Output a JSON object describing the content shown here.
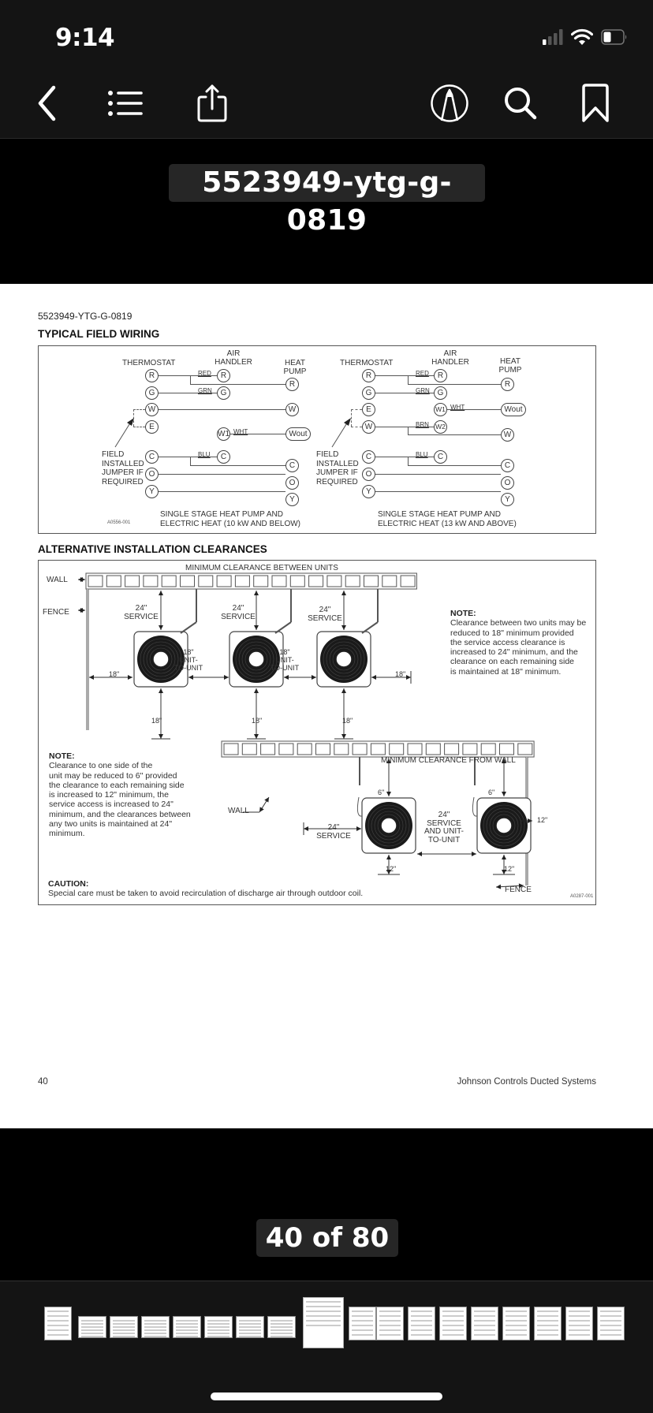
{
  "status_bar": {
    "time": "9:14",
    "signal_icon": "cellular-signal-icon",
    "wifi_icon": "wifi-icon",
    "battery_icon": "battery-icon"
  },
  "toolbar": {
    "back_icon": "chevron-left-icon",
    "outline_icon": "list-icon",
    "share_icon": "share-icon",
    "markup_icon": "markup-pen-icon",
    "search_icon": "search-icon",
    "bookmark_icon": "bookmark-icon"
  },
  "document": {
    "title": "5523949-ytg-g-0819"
  },
  "page": {
    "doc_id": "5523949-YTG-G-0819",
    "section1_title": "TYPICAL FIELD WIRING",
    "wiring_left": {
      "thermostat": "THERMOSTAT",
      "air_handler": [
        "AIR",
        "HANDLER"
      ],
      "heat_pump": [
        "HEAT",
        "PUMP"
      ],
      "thermostat_terminals": [
        "R",
        "G",
        "W",
        "E",
        "C",
        "O",
        "Y"
      ],
      "air_handler_terminals": [
        "R",
        "G",
        "W1",
        "C"
      ],
      "heat_pump_terminals": [
        "R",
        "W",
        "Wout",
        "C",
        "O",
        "Y"
      ],
      "wire_labels": [
        "RED",
        "GRN",
        "WHT",
        "BLU"
      ],
      "jumper_note": [
        "FIELD",
        "INSTALLED",
        "JUMPER IF",
        "REQUIRED"
      ],
      "caption": [
        "SINGLE STAGE HEAT PUMP AND",
        "ELECTRIC HEAT (10 kW AND BELOW)"
      ],
      "figure_id": "A0556-001"
    },
    "wiring_right": {
      "thermostat": "THERMOSTAT",
      "air_handler": [
        "AIR",
        "HANDLER"
      ],
      "heat_pump": [
        "HEAT",
        "PUMP"
      ],
      "thermostat_terminals": [
        "R",
        "G",
        "E",
        "W",
        "C",
        "O",
        "Y"
      ],
      "air_handler_terminals": [
        "R",
        "G",
        "W1",
        "W2",
        "C"
      ],
      "heat_pump_terminals": [
        "R",
        "Wout",
        "W",
        "C",
        "O",
        "Y"
      ],
      "wire_labels": [
        "RED",
        "GRN",
        "WHT",
        "BRN",
        "BLU"
      ],
      "jumper_note": [
        "FIELD",
        "INSTALLED",
        "JUMPER IF",
        "REQUIRED"
      ],
      "caption": [
        "SINGLE STAGE HEAT PUMP AND",
        "ELECTRIC HEAT (13 kW AND ABOVE)"
      ]
    },
    "section2_title": "ALTERNATIVE INSTALLATION CLEARANCES",
    "clearance_top": {
      "heading": "MINIMUM CLEARANCE BETWEEN UNITS",
      "wall": "WALL",
      "fence": "FENCE",
      "service": [
        "24\"",
        "SERVICE"
      ],
      "unit_to_unit": [
        "18\"",
        "UNIT-",
        "TO-UNIT"
      ],
      "side": "18\"",
      "bottom": "18\"",
      "note_title": "NOTE:",
      "note_lines": [
        "Clearance between two units may be",
        "reduced to 18\" minimum provided",
        "the service access clearance is",
        "increased to 24\" minimum, and the",
        "clearance on each remaining side",
        "is maintained at 18\" minimum."
      ]
    },
    "clearance_bottom": {
      "heading": "MINIMUM CLEARANCE FROM WALL",
      "wall": "WALL",
      "fence": "FENCE",
      "top_gap": "6\"",
      "service": [
        "24\"",
        "SERVICE"
      ],
      "between": [
        "24\"",
        "SERVICE",
        "AND UNIT-",
        "TO-UNIT"
      ],
      "side": "12\"",
      "bottom": "12\"",
      "note_title": "NOTE:",
      "note_lines": [
        "Clearance to one side of the",
        "unit may be reduced to 6\" provided",
        "the clearance to each remaining side",
        "is increased to 12\" minimum, the",
        "service access is increased to 24\"",
        "minimum, and the clearances between",
        "any two units is maintained at 24\"",
        "minimum."
      ],
      "caution_title": "CAUTION:",
      "caution_text": "Special care must be taken to avoid recirculation of discharge air through outdoor coil.",
      "figure_id": "A0287-001"
    },
    "page_number": "40",
    "publisher": "Johnson Controls Ducted Systems"
  },
  "pager": {
    "label": "40 of 80",
    "current": 40,
    "total": 80
  },
  "thumbnails": {
    "count_visible": 18,
    "selected_index": 8
  }
}
